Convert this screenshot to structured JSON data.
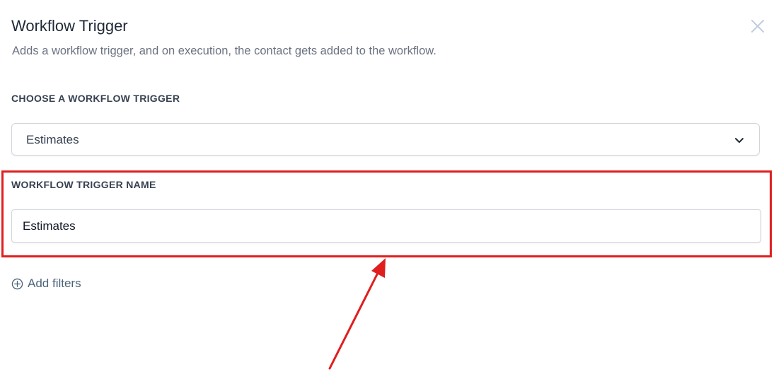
{
  "dialog": {
    "title": "Workflow Trigger",
    "subtitle": "Adds a workflow trigger, and on execution, the contact gets added to the workflow.",
    "close_icon": "close-icon"
  },
  "trigger_select": {
    "label": "CHOOSE A WORKFLOW TRIGGER",
    "selected_value": "Estimates",
    "icon": "chevron-down-icon"
  },
  "trigger_name": {
    "label": "WORKFLOW TRIGGER NAME",
    "value": "Estimates"
  },
  "filters": {
    "add_label": "Add filters",
    "icon": "plus-circle-icon"
  },
  "annotation": {
    "highlight_color": "#e01e1e",
    "arrow_color": "#e01e1e"
  },
  "colors": {
    "title": "#1f2937",
    "subtitle": "#6b7280",
    "link": "#4b6479",
    "border": "#d1d5db"
  }
}
